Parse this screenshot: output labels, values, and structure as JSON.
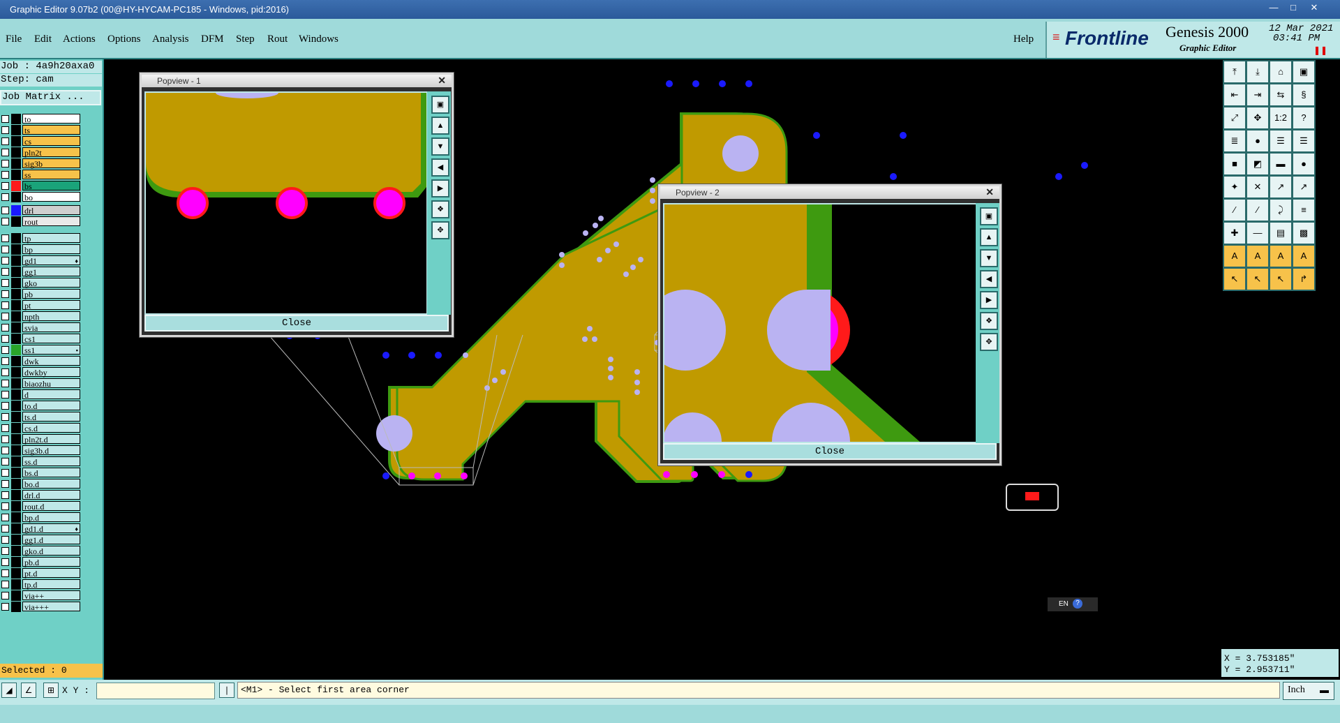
{
  "window": {
    "title": "Graphic Editor 9.07b2 (00@HY-HYCAM-PC185 - Windows, pid:2016)"
  },
  "menu": {
    "items": [
      "File",
      "Edit",
      "Actions",
      "Options",
      "Analysis",
      "DFM",
      "Step",
      "Rout",
      "Windows"
    ],
    "help": "Help"
  },
  "brand": {
    "name": "Frontline",
    "product": "Genesis 2000",
    "sub": "Graphic Editor",
    "date": "12 Mar 2021",
    "time": "03:41 PM"
  },
  "job": {
    "job_label": "Job : 4a9h20axa0",
    "step_label": "Step: cam",
    "matrix_btn": "Job Matrix ..."
  },
  "layers_board": [
    {
      "name": "to",
      "color": "#ffffff"
    },
    {
      "name": "ts",
      "color": "#f7c24a"
    },
    {
      "name": "cs",
      "color": "#f7c24a"
    },
    {
      "name": "pln2t",
      "color": "#f7c24a"
    },
    {
      "name": "sig3b",
      "color": "#f7c24a"
    },
    {
      "name": "ss",
      "color": "#f7c24a"
    },
    {
      "name": "bs",
      "color": "#1aa37a",
      "swatch": "#ff1a1a"
    },
    {
      "name": "bo",
      "color": "#ffffff"
    }
  ],
  "layers_drill": [
    {
      "name": "drl",
      "color": "#cfcfcf",
      "swatch": "#1a1aff"
    },
    {
      "name": "rout",
      "color": "#e9e9e9"
    }
  ],
  "layers_misc": [
    {
      "name": "tp"
    },
    {
      "name": "bp"
    },
    {
      "name": "gd1",
      "mark": "♦"
    },
    {
      "name": "gg1"
    },
    {
      "name": "gko"
    },
    {
      "name": "pb"
    },
    {
      "name": "pt"
    },
    {
      "name": "npth"
    },
    {
      "name": "svia"
    },
    {
      "name": "cs1"
    },
    {
      "name": "ss1",
      "swatch": "#2aa52a",
      "mark": "▪"
    },
    {
      "name": "dwk"
    },
    {
      "name": "dwkby"
    },
    {
      "name": "biaozhu"
    },
    {
      "name": "d"
    },
    {
      "name": "to.d"
    },
    {
      "name": "ts.d"
    },
    {
      "name": "cs.d"
    },
    {
      "name": "pln2t.d"
    },
    {
      "name": "sig3b.d"
    },
    {
      "name": "ss.d"
    },
    {
      "name": "bs.d"
    },
    {
      "name": "bo.d"
    },
    {
      "name": "drl.d"
    },
    {
      "name": "rout.d"
    },
    {
      "name": "bp.d"
    },
    {
      "name": "gd1.d",
      "mark": "♦"
    },
    {
      "name": "gg1.d"
    },
    {
      "name": "gko.d"
    },
    {
      "name": "pb.d"
    },
    {
      "name": "pt.d"
    },
    {
      "name": "tp.d"
    },
    {
      "name": "via++"
    },
    {
      "name": "via+++"
    }
  ],
  "selected": "Selected : 0",
  "popview1": {
    "title": "Popview - 1",
    "close": "Close"
  },
  "popview2": {
    "title": "Popview - 2",
    "close": "Close"
  },
  "coords": {
    "x": "X = 3.753185\"",
    "y": "Y = 2.953711\""
  },
  "bottom": {
    "xy_label": "X Y :",
    "xy_value": "",
    "prompt": "<M1> - Select first area corner",
    "units": "Inch"
  },
  "lang": "EN",
  "colors": {
    "copper": "#c09a00",
    "mask": "#3e9a10",
    "pad_lilac": "#bab3f2",
    "via_blue": "#1a1aff",
    "pad_magenta": "#ff00ff",
    "pad_red": "#ff1a1a",
    "panel_teal": "#6fd0c6"
  }
}
